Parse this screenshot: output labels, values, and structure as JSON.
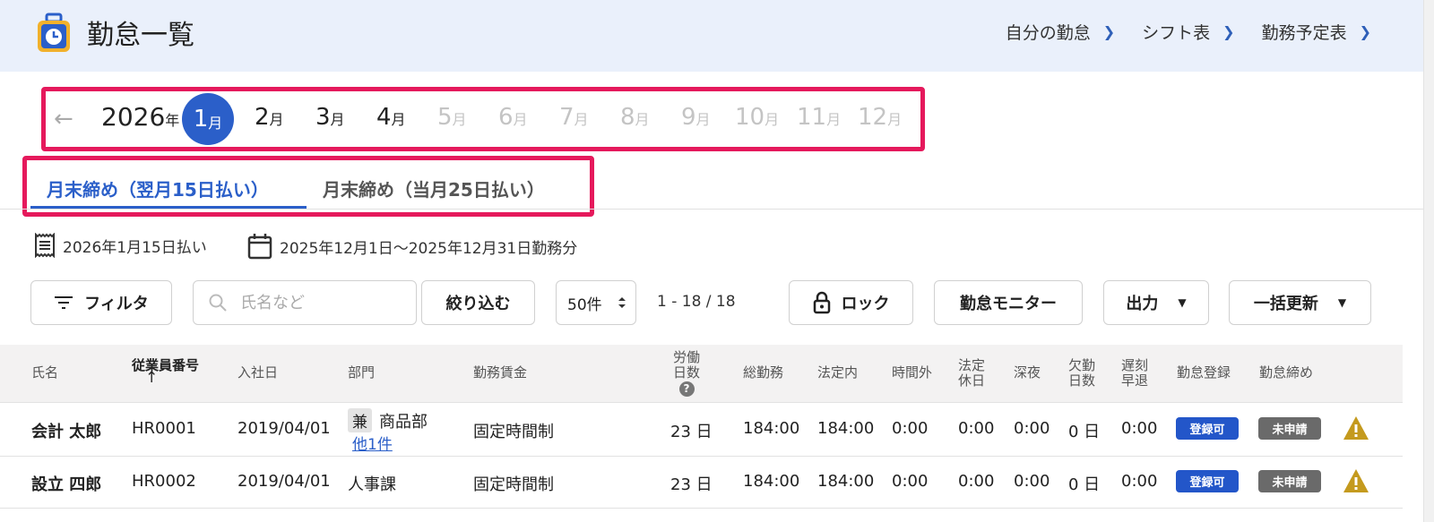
{
  "header": {
    "title": "勤怠一覧",
    "links": [
      "自分の勤怠",
      "シフト表",
      "勤務予定表"
    ]
  },
  "calendar": {
    "year": "2026",
    "year_unit": "年",
    "month_unit": "月",
    "months": [
      "1",
      "2",
      "3",
      "4",
      "5",
      "6",
      "7",
      "8",
      "9",
      "10",
      "11",
      "12"
    ],
    "active_month": "1"
  },
  "tabs": [
    "月末締め（翌月15日払い）",
    "月末締め（当月25日払い）"
  ],
  "info": {
    "pay_date": "2026年1月15日払い",
    "work_period": "2025年12月1日～2025年12月31日勤務分"
  },
  "toolbar": {
    "filter_label": "フィルタ",
    "search_placeholder": "氏名など",
    "narrow_label": "絞り込む",
    "per_page": "50件",
    "range": "1 - 18 / 18",
    "lock_label": "ロック",
    "monitor_label": "勤怠モニター",
    "output_label": "出力",
    "bulk_label": "一括更新"
  },
  "table": {
    "headers": {
      "name": "氏名",
      "emp_no": "従業員番号",
      "sort_arrow": "↑",
      "hire_date": "入社日",
      "dept": "部門",
      "wage": "勤務賃金",
      "work_days_1": "労働",
      "work_days_2": "日数",
      "help": "?",
      "total": "総勤務",
      "legal": "法定内",
      "overtime": "時間外",
      "holiday_1": "法定",
      "holiday_2": "休日",
      "night": "深夜",
      "absent_1": "欠勤",
      "absent_2": "日数",
      "late_1": "遅刻",
      "late_2": "早退",
      "registration": "勤怠登録",
      "closing": "勤怠締め"
    },
    "rows": [
      {
        "name": "会計 太郎",
        "emp_no": "HR0001",
        "hire_date": "2019/04/01",
        "dept_tag": "兼",
        "dept": "商品部",
        "dept_more": "他1件",
        "wage": "固定時間制",
        "work_days": "23 日",
        "total": "184:00",
        "legal": "184:00",
        "overtime": "0:00",
        "holiday": "0:00",
        "night": "0:00",
        "absent": "0 日",
        "late": "0:00",
        "registration": "登録可",
        "closing": "未申請"
      },
      {
        "name": "設立 四郎",
        "emp_no": "HR0002",
        "hire_date": "2019/04/01",
        "dept": "人事課",
        "wage": "固定時間制",
        "work_days": "23 日",
        "total": "184:00",
        "legal": "184:00",
        "overtime": "0:00",
        "holiday": "0:00",
        "night": "0:00",
        "absent": "0 日",
        "late": "0:00",
        "registration": "登録可",
        "closing": "未申請"
      }
    ]
  },
  "colors": {
    "accent": "#2b5fc9",
    "highlight": "#e5195c",
    "warning": "#c49a1e",
    "header_bg": "#eaf0fb"
  },
  "icons": {
    "app": "clock-bag-icon",
    "back": "arrow-left-icon",
    "filter": "filter-icon",
    "search": "search-icon",
    "lock": "lock-icon",
    "warning": "warning-icon"
  }
}
